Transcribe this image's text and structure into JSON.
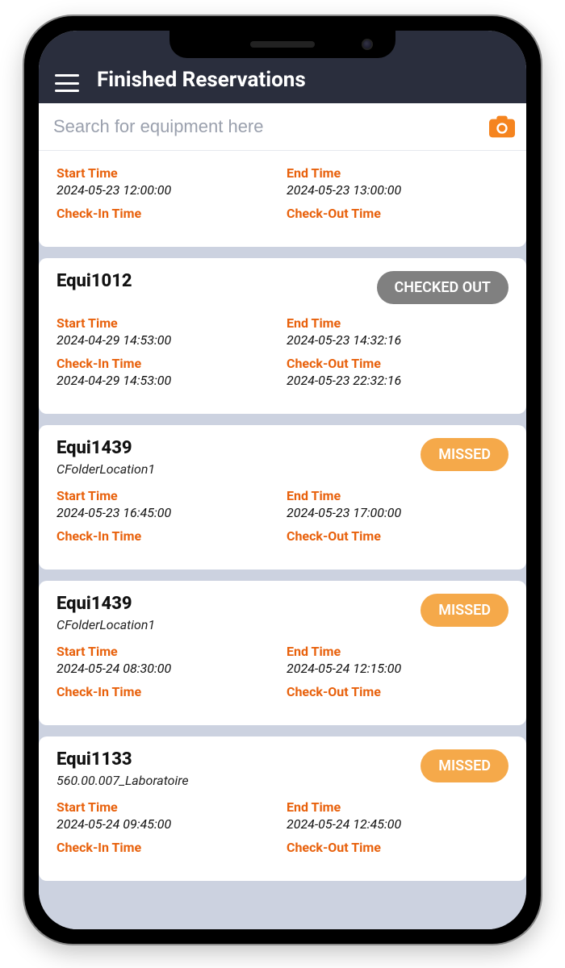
{
  "header": {
    "title": "Finished Reservations"
  },
  "search": {
    "placeholder": "Search for equipment here"
  },
  "labels": {
    "start": "Start Time",
    "end": "End Time",
    "checkin": "Check-In Time",
    "checkout": "Check-Out Time"
  },
  "status_labels": {
    "missed": "MISSED",
    "checked_out": "CHECKED OUT"
  },
  "cards": [
    {
      "title": "",
      "subtitle": "",
      "status": "",
      "start": "2024-05-23 12:00:00",
      "end": "2024-05-23 13:00:00",
      "checkin": "",
      "checkout": ""
    },
    {
      "title": "Equi1012",
      "subtitle": "",
      "status": "checked_out",
      "start": "2024-04-29 14:53:00",
      "end": "2024-05-23 14:32:16",
      "checkin": "2024-04-29 14:53:00",
      "checkout": "2024-05-23 22:32:16"
    },
    {
      "title": "Equi1439",
      "subtitle": "CFolderLocation1",
      "status": "missed",
      "start": "2024-05-23 16:45:00",
      "end": "2024-05-23 17:00:00",
      "checkin": "",
      "checkout": ""
    },
    {
      "title": "Equi1439",
      "subtitle": "CFolderLocation1",
      "status": "missed",
      "start": "2024-05-24 08:30:00",
      "end": "2024-05-24 12:15:00",
      "checkin": "",
      "checkout": ""
    },
    {
      "title": "Equi1133",
      "subtitle": "560.00.007_Laboratoire",
      "status": "missed",
      "start": "2024-05-24 09:45:00",
      "end": "2024-05-24 12:45:00",
      "checkin": "",
      "checkout": ""
    }
  ]
}
